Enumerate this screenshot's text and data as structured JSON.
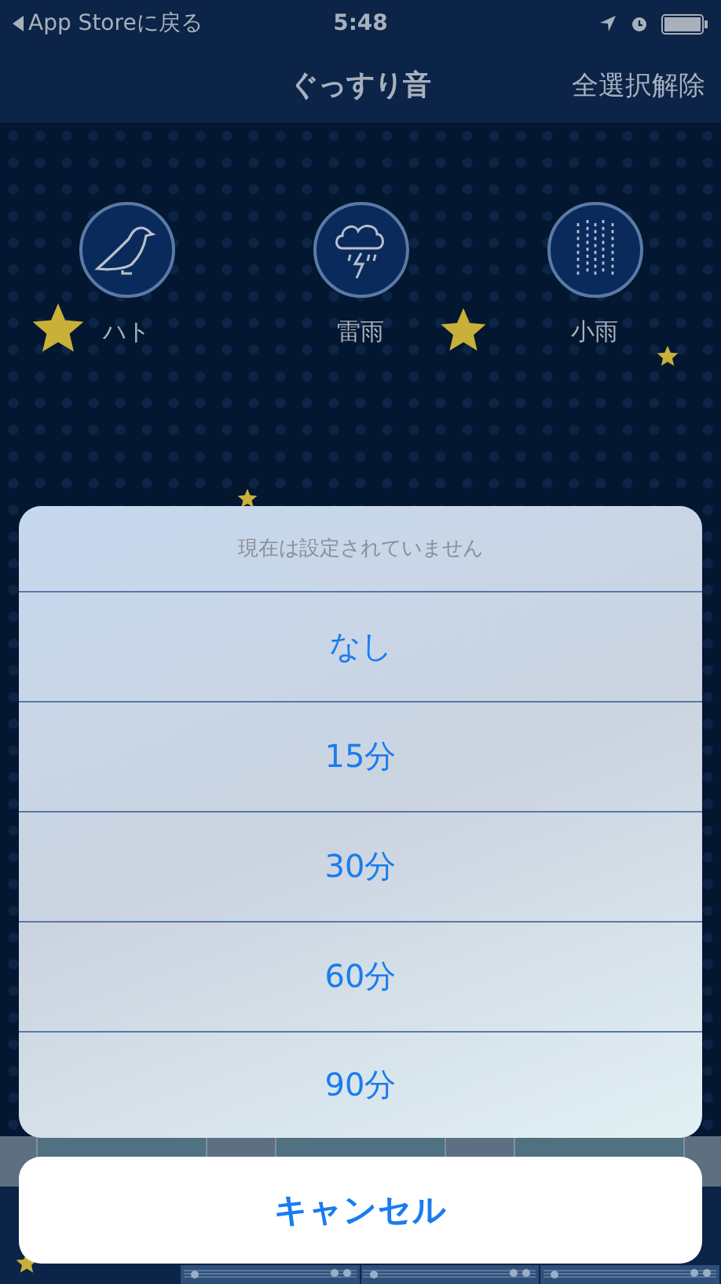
{
  "status_bar": {
    "back_label": "App Storeに戻る",
    "time": "5:48"
  },
  "nav": {
    "title": "ぐっすり音",
    "action": "全選択解除"
  },
  "sounds": [
    {
      "label": "ハト",
      "kind": "bird"
    },
    {
      "label": "雷雨",
      "kind": "storm"
    },
    {
      "label": "小雨",
      "kind": "rain"
    }
  ],
  "action_sheet": {
    "message": "現在は設定されていません",
    "options": [
      "なし",
      "15分",
      "30分",
      "60分",
      "90分"
    ],
    "cancel": "キャンセル"
  }
}
